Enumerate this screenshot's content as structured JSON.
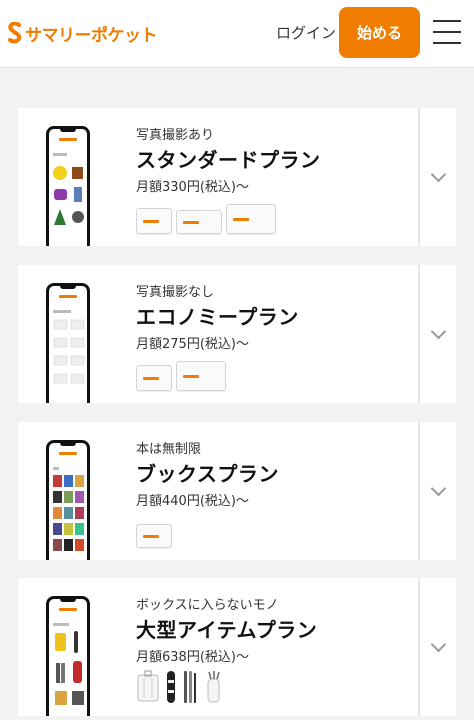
{
  "header": {
    "logo_text": "サマリーポケット",
    "login_label": "ログイン",
    "start_label": "始める"
  },
  "plans": [
    {
      "subtitle": "写真撮影あり",
      "title": "スタンダードプラン",
      "price": "月額330円(税込)〜",
      "thumbs": 3
    },
    {
      "subtitle": "写真撮影なし",
      "title": "エコノミープラン",
      "price": "月額275円(税込)〜",
      "thumbs": 2
    },
    {
      "subtitle": "本は無制限",
      "title": "ブックスプラン",
      "price": "月額440円(税込)〜",
      "thumbs": 1
    },
    {
      "subtitle": "ボックスに入らないモノ",
      "title": "大型アイテムプラン",
      "price": "月額638円(税込)〜",
      "thumbs": 4
    }
  ],
  "colors": {
    "brand": "#f07c00"
  },
  "icons": [
    "logo-icon",
    "hamburger-menu-icon",
    "chevron-down-icon"
  ]
}
